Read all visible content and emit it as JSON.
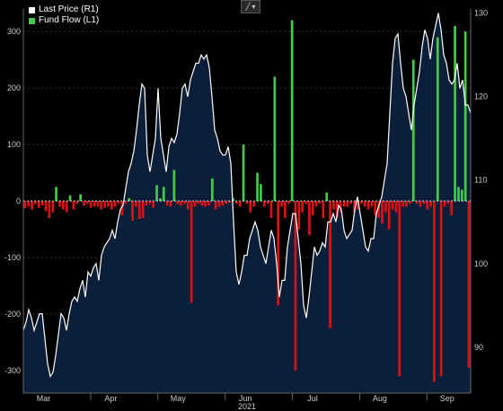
{
  "legend": {
    "items": [
      {
        "label": "Last Price (R1)",
        "color": "#ffffff"
      },
      {
        "label": "Fund Flow (L1)",
        "color": "#44cc44"
      }
    ]
  },
  "toolbar": {
    "icon": "chart-type-icon"
  },
  "chart_data": {
    "type": "bar+area",
    "x_labels": [
      "Mar",
      "Apr",
      "May",
      "Jun",
      "Jul",
      "Aug",
      "Sep"
    ],
    "x_year_label": "2021",
    "left_axis": {
      "ticks": [
        300,
        200,
        100,
        0,
        -100,
        -200,
        -300
      ],
      "ylim": [
        -340,
        340
      ]
    },
    "right_axis": {
      "ticks": [
        130,
        120,
        110,
        100,
        90
      ],
      "ylim": [
        84.5,
        130.5
      ]
    },
    "colors": {
      "positive": "#44cc44",
      "negative": "#dd1111",
      "area": "#0b1e3a",
      "line": "#ffffff",
      "zero_line": "#dddddd"
    },
    "series": [
      {
        "name": "Fund Flow (L1)",
        "axis": "left",
        "values": [
          -13,
          -10,
          -15,
          -5,
          -12,
          -8,
          -18,
          -30,
          -20,
          25,
          -10,
          -15,
          -20,
          10,
          -15,
          -5,
          12,
          -8,
          -5,
          -12,
          -10,
          -10,
          -15,
          -12,
          -10,
          -15,
          -10,
          -5,
          -25,
          -5,
          5,
          -35,
          -10,
          -32,
          -30,
          -8,
          -5,
          -12,
          28,
          5,
          25,
          -8,
          -10,
          55,
          -6,
          -8,
          -5,
          -15,
          -180,
          -10,
          -5,
          -8,
          -10,
          -8,
          40,
          -15,
          -10,
          -8,
          -5,
          -3,
          5,
          -5,
          -10,
          100,
          -5,
          -20,
          -10,
          50,
          30,
          -10,
          -5,
          -30,
          220,
          -185,
          -10,
          -30,
          -5,
          320,
          -300,
          -50,
          -20,
          -5,
          -60,
          -25,
          -10,
          -5,
          -30,
          15,
          -225,
          -15,
          -30,
          -20,
          -10,
          -10,
          -5,
          -20,
          -15,
          -5,
          -10,
          -15,
          -10,
          -25,
          -30,
          -40,
          -20,
          -50,
          -15,
          -20,
          -310,
          -10,
          -10,
          -5,
          250,
          -5,
          -10,
          -5,
          -15,
          -10,
          -320,
          290,
          -310,
          -10,
          -5,
          -25,
          310,
          25,
          20,
          300,
          -295
        ]
      },
      {
        "name": "Last Price (R1)",
        "axis": "right",
        "values": [
          92,
          93,
          94.5,
          93.5,
          92,
          93,
          94,
          94,
          91,
          88,
          86.5,
          87,
          89,
          91.5,
          94,
          93.5,
          92,
          94,
          95.5,
          96,
          95.5,
          97,
          98,
          96,
          99,
          98.5,
          99.5,
          100,
          98,
          101,
          102,
          102.5,
          103,
          104,
          103,
          105,
          106.5,
          107,
          109,
          111,
          112,
          113.5,
          116,
          119,
          121.5,
          121,
          113,
          111,
          113,
          115,
          121,
          115,
          113,
          111,
          114,
          115,
          114.5,
          115.5,
          118,
          121,
          121.5,
          120,
          122,
          123,
          124,
          124,
          125,
          124.5,
          125,
          123.5,
          120,
          116,
          115,
          113.5,
          113,
          113,
          114,
          112,
          105,
          99,
          97.5,
          99,
          101,
          101,
          103,
          104,
          105,
          104,
          102,
          101,
          100,
          102,
          104,
          103,
          100,
          96,
          98,
          98,
          102,
          104,
          106,
          106,
          103,
          100,
          95,
          93.5,
          96,
          99,
          102,
          101,
          101.5,
          102.5,
          102,
          105,
          105,
          106,
          105,
          107,
          106.5,
          104,
          103,
          103.5,
          104,
          106.5,
          108,
          106,
          104,
          102,
          101.5,
          103,
          103,
          106,
          107,
          108,
          110,
          112,
          118,
          124,
          127,
          127.5,
          124,
          121,
          120,
          118,
          116,
          119,
          121,
          123,
          126,
          128,
          127,
          124.5,
          127,
          128.5,
          130,
          128,
          125,
          124,
          122,
          121.5,
          122,
          124,
          121,
          122,
          119,
          119,
          118
        ]
      }
    ]
  }
}
